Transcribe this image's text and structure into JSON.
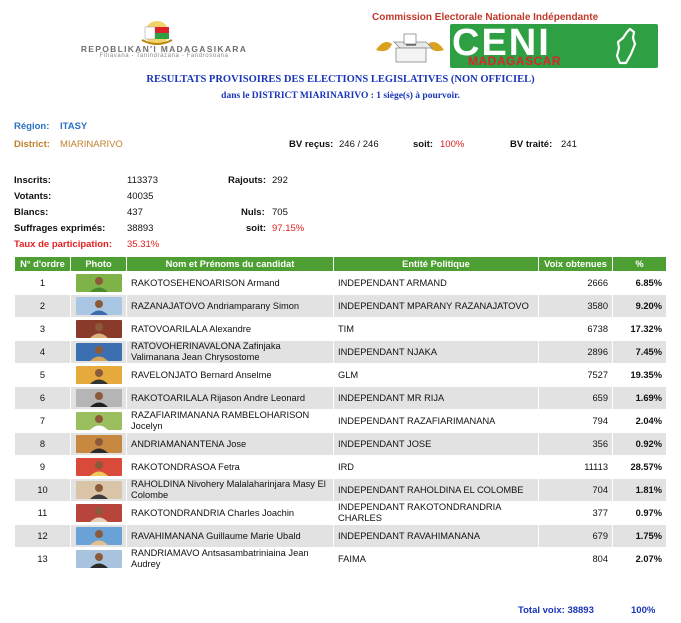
{
  "header": {
    "republic_title": "REPOBLIKAN'I MADAGASIKARA",
    "republic_motto": "Fitiavana - Tanindrazana - Fandrosoana",
    "commission": "Commission Electorale Nationale Indépendante",
    "ceni_logo_text": "CENI",
    "ceni_logo_sub": "MADAGASCAR",
    "title": "RESULTATS PROVISOIRES DES ELECTIONS LEGISLATIVES (NON OFFICIEL)",
    "subtitle": "dans le DISTRICT  MIARINARIVO : 1 siège(s) à pourvoir."
  },
  "info": {
    "region_label": "Région:",
    "region_value": "ITASY",
    "district_label": "District:",
    "district_value": "MIARINARIVO",
    "bv_recus_label": "BV reçus:",
    "bv_recus_value": "246 / 246",
    "soit_label": "soit:",
    "soit_value": "100%",
    "bv_traite_label": "BV traité:",
    "bv_traite_value": "241",
    "inscrits_label": "Inscrits:",
    "inscrits_value": "113373",
    "rajouts_label": "Rajouts:",
    "rajouts_value": "292",
    "votants_label": "Votants:",
    "votants_value": "40035",
    "blancs_label": "Blancs:",
    "blancs_value": "437",
    "nuls_label": "Nuls:",
    "nuls_value": "705",
    "suffrages_label": "Suffrages exprimés:",
    "suffrages_value": "38893",
    "soit2_label": "soit:",
    "soit2_value": "97.15%",
    "taux_label": "Taux de participation:",
    "taux_value": "35.31%"
  },
  "table": {
    "headers": [
      "N° d'ordre",
      "Photo",
      "Nom et Prénoms du candidat",
      "Entité Politique",
      "Voix obtenues",
      "%"
    ],
    "rows": [
      {
        "num": "1",
        "name": "RAKOTOSEHENOARISON Armand",
        "entity": "INDEPENDANT ARMAND",
        "votes": "2666",
        "pct": "6.85%"
      },
      {
        "num": "2",
        "name": "RAZANAJATOVO Andriamparany Simon",
        "entity": "INDEPENDANT MPARANY RAZANAJATOVO",
        "votes": "3580",
        "pct": "9.20%"
      },
      {
        "num": "3",
        "name": "RATOVOARILALA Alexandre",
        "entity": "TIM",
        "votes": "6738",
        "pct": "17.32%"
      },
      {
        "num": "4",
        "name": "RATOVOHERINAVALONA Zafinjaka Valimanana Jean Chrysostome",
        "entity": "INDEPENDANT NJAKA",
        "votes": "2896",
        "pct": "7.45%"
      },
      {
        "num": "5",
        "name": "RAVELONJATO Bernard Anselme",
        "entity": "GLM",
        "votes": "7527",
        "pct": "19.35%"
      },
      {
        "num": "6",
        "name": "RAKOTOARILALA Rijason Andre Leonard",
        "entity": "INDEPENDANT MR RIJA",
        "votes": "659",
        "pct": "1.69%"
      },
      {
        "num": "7",
        "name": "RAZAFIARIMANANA RAMBELOHARISON Jocelyn",
        "entity": "INDEPENDANT RAZAFIARIMANANA",
        "votes": "794",
        "pct": "2.04%"
      },
      {
        "num": "8",
        "name": "ANDRIAMANANTENA Jose",
        "entity": "INDEPENDANT JOSE",
        "votes": "356",
        "pct": "0.92%"
      },
      {
        "num": "9",
        "name": "RAKOTONDRASOA Fetra",
        "entity": "IRD",
        "votes": "11113",
        "pct": "28.57%"
      },
      {
        "num": "10",
        "name": "RAHOLDINA Nivohery Malalaharinjara Masy El Colombe",
        "entity": "INDEPENDANT RAHOLDINA EL COLOMBE",
        "votes": "704",
        "pct": "1.81%"
      },
      {
        "num": "11",
        "name": "RAKOTONDRANDRIA Charles Joachin",
        "entity": "INDEPENDANT RAKOTONDRANDRIA CHARLES",
        "votes": "377",
        "pct": "0.97%"
      },
      {
        "num": "12",
        "name": "RAVAHIMANANA Guillaume Marie Ubald",
        "entity": "INDEPENDANT RAVAHIMANANA",
        "votes": "679",
        "pct": "1.75%"
      },
      {
        "num": "13",
        "name": "RANDRIAMAVO Antsasambatriniaina Jean Audrey",
        "entity": "FAIMA",
        "votes": "804",
        "pct": "2.07%"
      }
    ],
    "total_label": "Total voix:",
    "total_votes": "38893",
    "total_pct": "100%"
  },
  "colors": {
    "header_green": "#4e9f33",
    "title_blue": "#1a35b8",
    "label_blue": "#2b72c8",
    "district_orange": "#c27f2a",
    "alert_red": "#e02020",
    "row_shade": "#e2e2e2"
  }
}
